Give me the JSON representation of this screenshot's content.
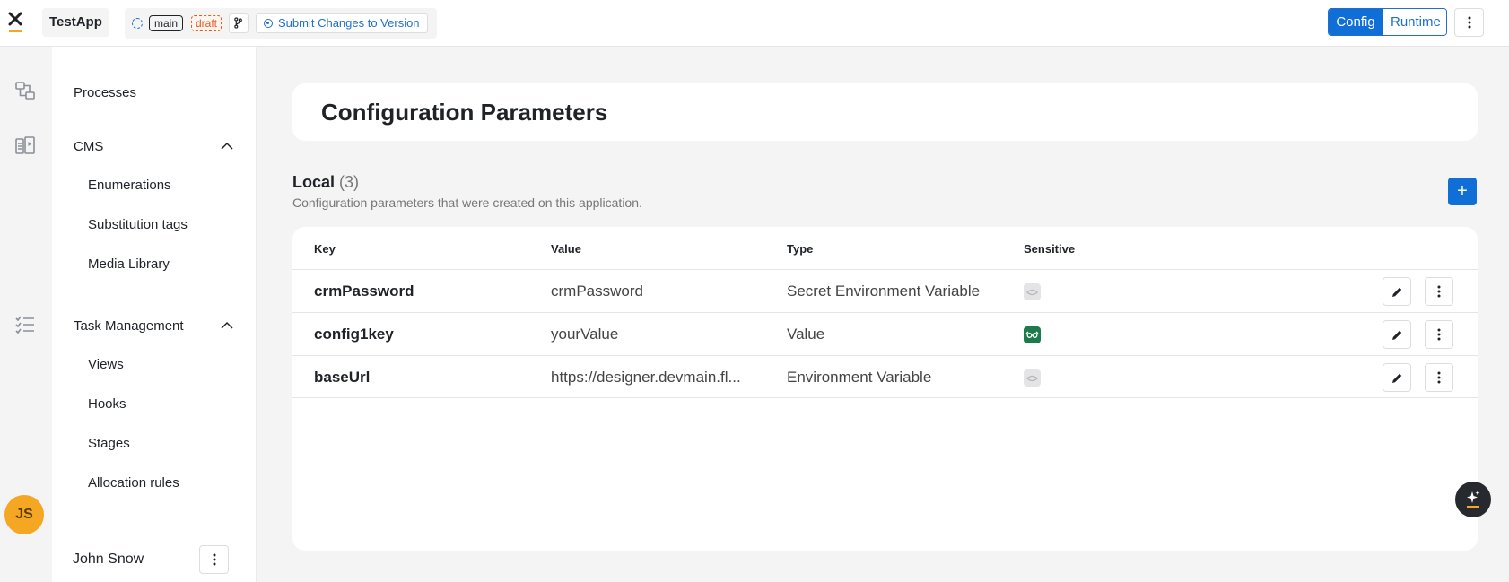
{
  "topbar": {
    "app_name": "TestApp",
    "branch": "main",
    "status": "draft",
    "submit_label": "Submit Changes to Version",
    "modes": [
      "Config",
      "Runtime"
    ],
    "active_mode": "Config",
    "accent": "#0f6fd6"
  },
  "rail": {
    "icons": [
      "processes-icon",
      "cms-icon",
      "task-management-icon"
    ]
  },
  "sidebar": {
    "processes": "Processes",
    "cms": {
      "label": "CMS",
      "items": [
        "Enumerations",
        "Substitution tags",
        "Media Library"
      ]
    },
    "task_management": {
      "label": "Task Management",
      "items": [
        "Views",
        "Hooks",
        "Stages",
        "Allocation rules"
      ]
    },
    "user": {
      "initials": "JS",
      "name": "John Snow"
    }
  },
  "main": {
    "title": "Configuration Parameters",
    "section": {
      "title": "Local",
      "count": "(3)",
      "description": "Configuration parameters that were created on this application.",
      "add_label": "+"
    },
    "table": {
      "columns": [
        "Key",
        "Value",
        "Type",
        "Sensitive"
      ],
      "rows": [
        {
          "key": "crmPassword",
          "value": "crmPassword",
          "type": "Secret Environment Variable",
          "sensitive": false
        },
        {
          "key": "config1key",
          "value": "yourValue",
          "type": "Value",
          "sensitive": true
        },
        {
          "key": "baseUrl",
          "value": "https://designer.devmain.fl...",
          "type": "Environment Variable",
          "sensitive": false
        }
      ]
    }
  }
}
